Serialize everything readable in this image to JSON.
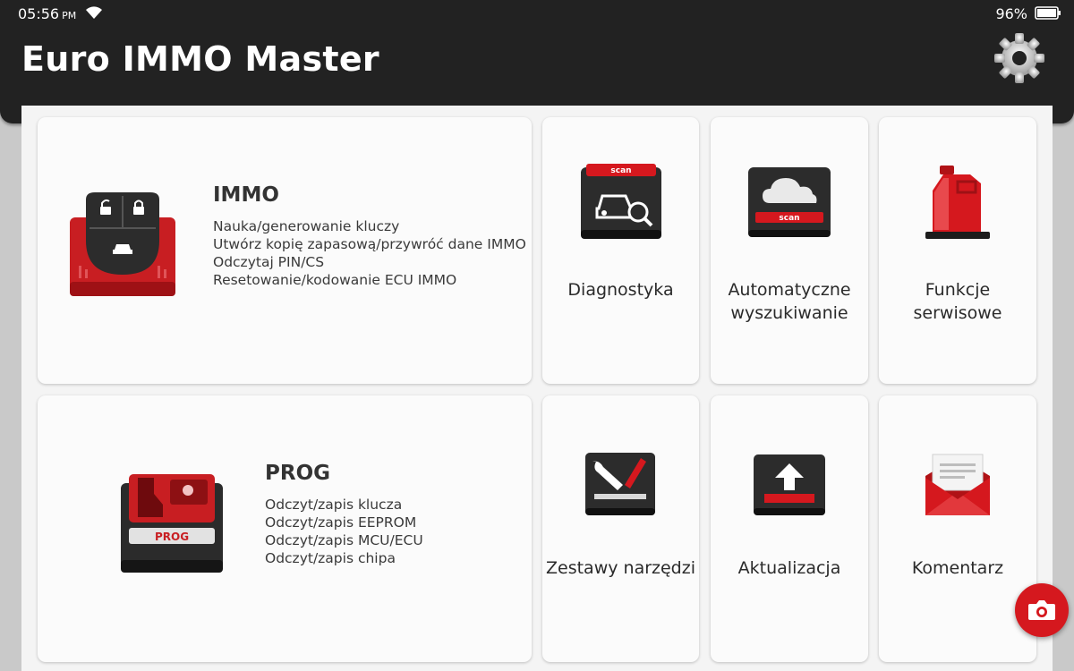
{
  "status_bar": {
    "time": "05:56",
    "ampm": "PM",
    "battery": "96%"
  },
  "header": {
    "title": "Euro IMMO Master",
    "settings_icon": "gear-icon"
  },
  "colors": {
    "header_bg": "#222222",
    "accent_red": "#d5181e",
    "tile_bg": "#fbfbfb",
    "panel_bg": "#f4f4f4"
  },
  "immo": {
    "title": "IMMO",
    "lines": [
      "Nauka/generowanie kluczy",
      "Utwórz kopię zapasową/przywróć dane IMMO",
      "Odczytaj PIN/CS",
      "Resetowanie/kodowanie ECU IMMO"
    ],
    "icon": "car-key-fob-icon"
  },
  "prog": {
    "title": "PROG",
    "badge": "PROG",
    "lines": [
      "Odczyt/zapis klucza",
      "Odczyt/zapis EEPROM",
      "Odczyt/zapis MCU/ECU",
      "Odczyt/zapis chipa"
    ],
    "icon": "programmer-device-icon"
  },
  "tiles": {
    "diagnostics": {
      "line1": "Diagnostyka",
      "line2": "",
      "icon_badge": "scan",
      "icon": "car-scan-icon"
    },
    "auto_search": {
      "line1": "Automatyczne",
      "line2": "wyszukiwanie",
      "icon_badge": "scan",
      "icon": "cloud-scan-icon"
    },
    "service": {
      "line1": "Funkcje",
      "line2": "serwisowe",
      "icon": "oil-canister-icon"
    },
    "toolkits": {
      "line1": "Zestawy narzędzi",
      "line2": "",
      "icon": "wrench-screwdriver-icon"
    },
    "update": {
      "line1": "Aktualizacja",
      "line2": "",
      "icon": "upload-arrow-icon"
    },
    "feedback": {
      "line1": "Komentarz",
      "line2": "",
      "icon": "envelope-icon"
    }
  },
  "fab": {
    "icon": "camera-icon"
  }
}
